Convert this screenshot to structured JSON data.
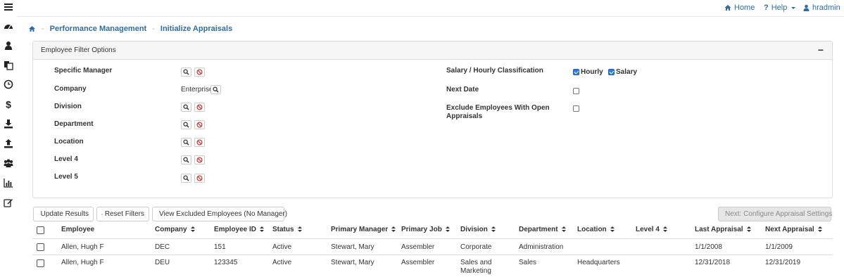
{
  "sidebar": {
    "items": [
      {
        "icon": "menu-icon"
      },
      {
        "icon": "dashboard-icon"
      },
      {
        "icon": "user-icon"
      },
      {
        "icon": "documents-icon"
      },
      {
        "icon": "clock-icon"
      },
      {
        "icon": "dollar-icon"
      },
      {
        "icon": "download-icon"
      },
      {
        "icon": "upload-icon"
      },
      {
        "icon": "users-icon"
      },
      {
        "icon": "bar-chart-icon"
      },
      {
        "icon": "edit-icon"
      }
    ]
  },
  "header": {
    "home_label": "Home",
    "help_label": "Help",
    "user_label": "hradmin"
  },
  "breadcrumb": {
    "level1": "Performance Management",
    "level2": "Initialize Appraisals"
  },
  "filters": {
    "title": "Employee Filter Options",
    "collapse_label": "−",
    "specific_manager": "Specific Manager",
    "company": "Company",
    "company_value": "Enterprise",
    "division": "Division",
    "department": "Department",
    "location": "Location",
    "level4": "Level 4",
    "level5": "Level 5",
    "salary_hourly": "Salary / Hourly Classification",
    "hourly": "Hourly",
    "salary": "Salary",
    "next_date": "Next Date",
    "exclude_open_line1": "Exclude Employees With Open",
    "exclude_open_line2": "Appraisals"
  },
  "actions": {
    "update_results": "Update Results",
    "reset_filters": "Reset Filters",
    "view_excluded": "View Excluded Employees (No Manager)",
    "next_step": "Next: Configure Appraisal Settings"
  },
  "table": {
    "headers": {
      "employee": "Employee",
      "company": "Company",
      "employee_id": "Employee ID",
      "status": "Status",
      "primary_manager": "Primary Manager",
      "primary_job": "Primary Job",
      "division": "Division",
      "department": "Department",
      "location": "Location",
      "level4": "Level 4",
      "last_appraisal": "Last Appraisal",
      "next_appraisal": "Next Appraisal"
    },
    "rows": [
      {
        "employee": "Allen, Hugh F",
        "company": "DEC",
        "employee_id": "151",
        "status": "Active",
        "primary_manager": "Stewart, Mary",
        "primary_job": "Assembler",
        "division_l1": "Corporate",
        "division_l2": "",
        "department": "Administration",
        "location": "",
        "level4": "",
        "last_appraisal": "1/1/2008",
        "next_appraisal": "1/1/2009"
      },
      {
        "employee": "Allen, Hugh F",
        "company": "DEU",
        "employee_id": "123345",
        "status": "Active",
        "primary_manager": "Stewart, Mary",
        "primary_job": "Assembler",
        "division_l1": "Sales and",
        "division_l2": "Marketing",
        "department": "Sales",
        "location": "Headquarters",
        "level4": "",
        "last_appraisal": "12/31/2018",
        "next_appraisal": "12/31/2019"
      }
    ]
  },
  "colors": {
    "link": "#2e6da4",
    "checkbox_checked": "#2c7be5",
    "cancel_icon": "#c9302c"
  }
}
